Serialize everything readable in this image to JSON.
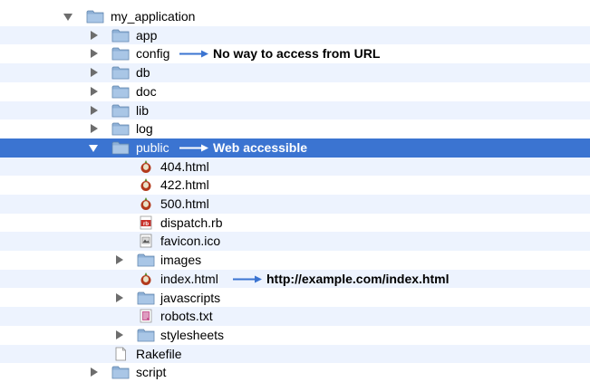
{
  "tree": {
    "root": "my_application",
    "items": [
      {
        "label": "app"
      },
      {
        "label": "config",
        "annotation": "No way to access from URL"
      },
      {
        "label": "db"
      },
      {
        "label": "doc"
      },
      {
        "label": "lib"
      },
      {
        "label": "log"
      },
      {
        "label": "public",
        "annotation": "Web accessible",
        "selected": true
      },
      {
        "label": "404.html"
      },
      {
        "label": "422.html"
      },
      {
        "label": "500.html"
      },
      {
        "label": "dispatch.rb"
      },
      {
        "label": "favicon.ico"
      },
      {
        "label": "images"
      },
      {
        "label": "index.html",
        "annotation": "http://example.com/index.html"
      },
      {
        "label": "javascripts"
      },
      {
        "label": "robots.txt"
      },
      {
        "label": "stylesheets"
      },
      {
        "label": "Rakefile"
      },
      {
        "label": "script"
      }
    ]
  },
  "colors": {
    "selection": "#3b74d1",
    "stripe": "#edf3fe",
    "annotation_arrow": "#3b74d1",
    "folder": "#7a9fc6"
  },
  "icons": {
    "folder": "folder-icon",
    "html": "html-file-icon",
    "ruby": "ruby-file-icon",
    "image": "image-file-icon",
    "text": "text-file-icon",
    "generic": "document-icon",
    "arrow": "arrow-right-icon"
  }
}
